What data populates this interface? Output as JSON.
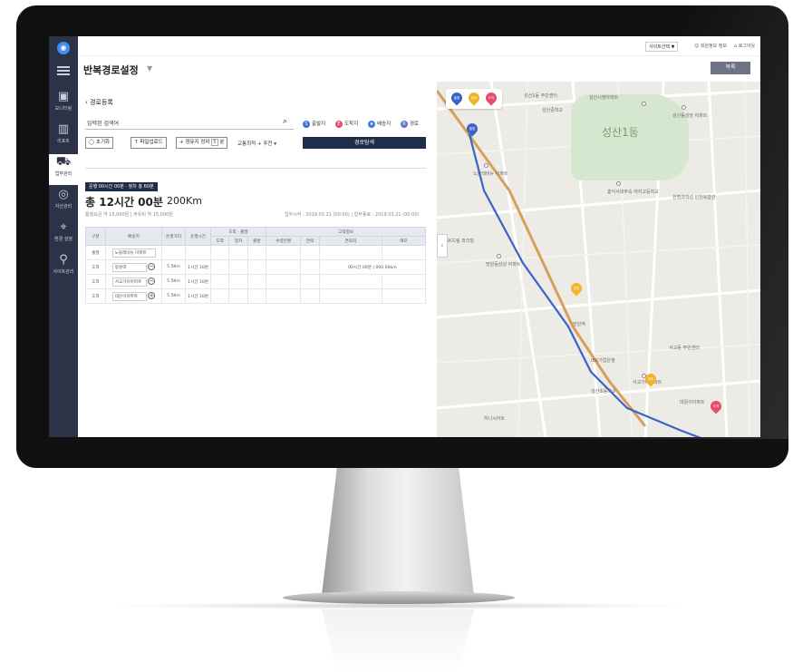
{
  "sidebar": {
    "items": [
      {
        "icon": "monitor-icon",
        "label": "모니터링"
      },
      {
        "icon": "chart-icon",
        "label": "리포트"
      },
      {
        "icon": "truck-icon",
        "label": "업무관리"
      },
      {
        "icon": "asset-icon",
        "label": "자산관리"
      },
      {
        "icon": "pin-icon",
        "label": "환경 설정"
      },
      {
        "icon": "user-icon",
        "label": "사이트관리"
      }
    ]
  },
  "topbar": {
    "site_select": "사이트선택 ▼",
    "my_info": "회원정보 정보",
    "logout": "로그아웃"
  },
  "header": {
    "title": "반복경로설정",
    "title_caret": "▼",
    "list_button": "목록"
  },
  "route": {
    "back_label": "경로등록",
    "search_value": "입력된 검색어",
    "legend": [
      {
        "label": "출발지",
        "color": "#3b6fd8",
        "mark": "S"
      },
      {
        "label": "도착지",
        "color": "#e94b6a",
        "mark": "E"
      },
      {
        "label": "배송지",
        "color": "#3f7fd3",
        "mark": "★"
      },
      {
        "label": "경로",
        "color": "#5877c9",
        "mark": "R"
      }
    ],
    "reset_button": "초기화",
    "upload_button": "파일업로드",
    "waypoint_button": "경유지 정차",
    "waypoint_count": "5",
    "waypoint_unit": "분",
    "traffic_select": "교통최적 + 추천",
    "search_route_button": "경로탐색"
  },
  "summary": {
    "tag": "운행 00시간 00분 · 정차 총 60분",
    "total_time": "총 12시간 00분",
    "total_distance": "200Km",
    "fees": "통행요금 약 15,000원  |  주유비 약 15,000원",
    "schedule": "업무시작 : 2019.03.21 (00:00)   |   업무종료 : 2019.03.21 (00:00)"
  },
  "table": {
    "headers_top": [
      "구분",
      "배송지",
      "운행거리",
      "운행시간",
      "도착 · 출발",
      "고객정보"
    ],
    "headers_sub": [
      "도착",
      "정차",
      "출발",
      "수령인명",
      "연락",
      "연락처",
      "메모"
    ],
    "rows": [
      {
        "type": "출발",
        "place": "노블레비뉴 아파트",
        "distance": "",
        "time": "",
        "note": "",
        "ctl": ""
      },
      {
        "type": "도착",
        "place": "망원역",
        "distance": "5.5Km",
        "time": "1시간 10분",
        "note": "00시간 00분 | 000.00km",
        "ctl": "−"
      },
      {
        "type": "도착",
        "place": "서교가이아파트",
        "distance": "5.5Km",
        "time": "1시간 10분",
        "note": "",
        "ctl": "−"
      },
      {
        "type": "도착",
        "place": "대문이아파트",
        "distance": "5.5Km",
        "time": "1시간 10분",
        "note": "",
        "ctl": "+"
      }
    ]
  },
  "map": {
    "area_label": "성산1동",
    "labels": [
      {
        "text": "성산1동 주민센터"
      },
      {
        "text": "성산시영아파트"
      },
      {
        "text": "성산중학교"
      },
      {
        "text": "성산동성당 아파트"
      },
      {
        "text": "노블레비뉴 아파트"
      },
      {
        "text": "홍익사대부속 여자고등학교"
      },
      {
        "text": "한명과학성 인천복합관"
      },
      {
        "text": "망원역"
      },
      {
        "text": "서교가이아파트"
      },
      {
        "text": "대문이아파트"
      },
      {
        "text": "SK드림 파크빌"
      },
      {
        "text": "망원동삼성 아파트"
      },
      {
        "text": "IBK기업은행"
      },
      {
        "text": "성산초등학교"
      },
      {
        "text": "서교동 주민센터"
      },
      {
        "text": "하나시아트"
      }
    ],
    "tab_labels": [
      "출발",
      "경유",
      "도착"
    ],
    "pin_labels": [
      "출발",
      "경유",
      "경유",
      "도착"
    ],
    "colors": {
      "route": "#3a63c8",
      "start": "#3a63c8",
      "via": "#f0b429",
      "end": "#e94b6a"
    }
  }
}
